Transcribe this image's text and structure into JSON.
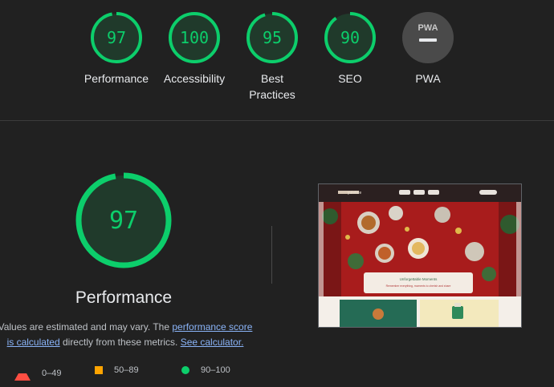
{
  "categories": [
    {
      "score": "97",
      "label": "Performance"
    },
    {
      "score": "100",
      "label": "Accessibility"
    },
    {
      "score": "95",
      "label": "Best Practices"
    },
    {
      "score": "90",
      "label": "SEO"
    },
    {
      "badge": "PWA",
      "label": "PWA"
    }
  ],
  "performance": {
    "score": "97",
    "title": "Performance",
    "note_prefix": "Values are estimated and may vary. The ",
    "link_score": "performance score is calculated",
    "note_middle": " directly from these metrics. ",
    "link_calc": "See calculator."
  },
  "legend": [
    {
      "range": "0–49"
    },
    {
      "range": "50–89"
    },
    {
      "range": "90–100"
    }
  ],
  "screenshot": {
    "brand": "yuletide",
    "banner_title": "Unforgettable Moments",
    "banner_text": "Remember everything, moments to cherish and share"
  },
  "colors": {
    "pass": "#0cce6b",
    "average": "#ffa400",
    "fail": "#ff4e42",
    "link": "#8ab4f8"
  }
}
